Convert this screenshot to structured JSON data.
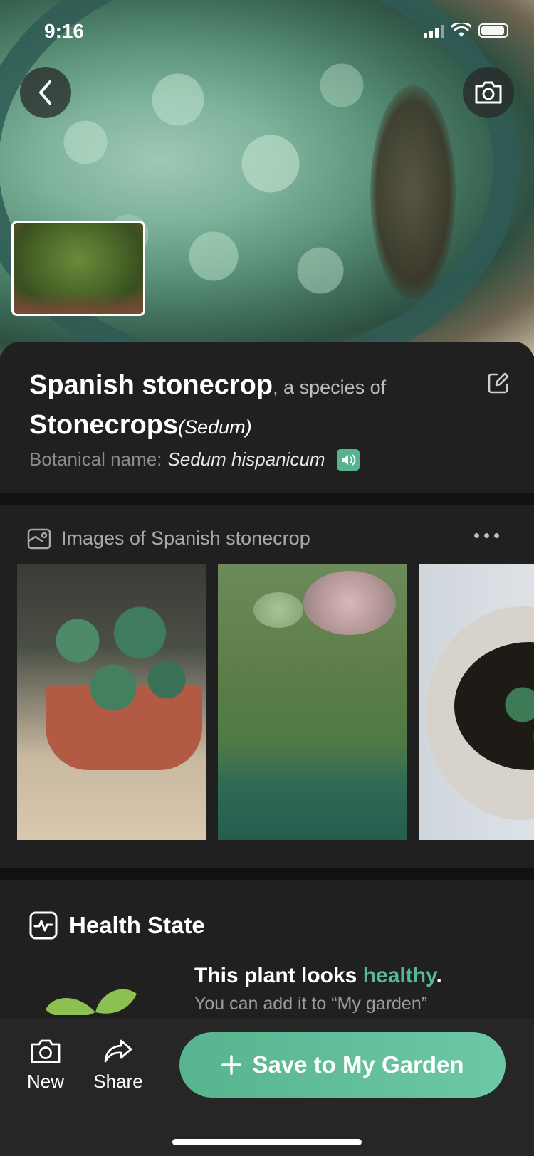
{
  "status_bar": {
    "time": "9:16"
  },
  "header": {
    "back_icon": "chevron-left-icon",
    "camera_icon": "camera-icon"
  },
  "plant": {
    "common_name": "Spanish stonecrop",
    "species_of_text": ", a species of",
    "genus_common": "Stonecrops",
    "genus_latin": "(Sedum)",
    "botanical_label": "Botanical name:",
    "botanical_name": "Sedum hispanicum"
  },
  "images_section": {
    "title": "Images of Spanish stonecrop",
    "icon": "image-icon"
  },
  "health": {
    "title": "Health State",
    "line1_prefix": "This plant looks ",
    "line1_status": "healthy",
    "line1_suffix": ".",
    "line2": "You can add it to “My garden”"
  },
  "bottom_bar": {
    "new_label": "New",
    "share_label": "Share",
    "save_label": "Save to My Garden"
  },
  "colors": {
    "accent": "#58b48f",
    "card_bg": "#202020",
    "separator": "#111111"
  }
}
